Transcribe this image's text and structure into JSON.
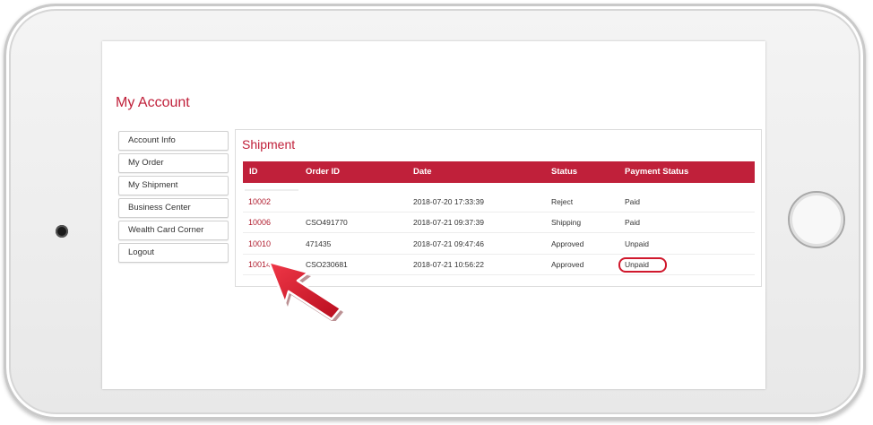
{
  "page": {
    "title": "My Account"
  },
  "sidebar": {
    "items": [
      {
        "label": "Account Info"
      },
      {
        "label": "My Order"
      },
      {
        "label": "My Shipment"
      },
      {
        "label": "Business Center"
      },
      {
        "label": "Wealth Card Corner"
      },
      {
        "label": "Logout"
      }
    ]
  },
  "shipment": {
    "title": "Shipment",
    "columns": [
      "ID",
      "Order ID",
      "Date",
      "Status",
      "Payment Status"
    ],
    "rows": [
      {
        "id": "10002",
        "order_id": "",
        "date": "2018-07-20 17:33:39",
        "status": "Reject",
        "payment_status": "Paid"
      },
      {
        "id": "10006",
        "order_id": "CSO491770",
        "date": "2018-07-21 09:37:39",
        "status": "Shipping",
        "payment_status": "Paid"
      },
      {
        "id": "10010",
        "order_id": "471435",
        "date": "2018-07-21 09:47:46",
        "status": "Approved",
        "payment_status": "Unpaid"
      },
      {
        "id": "10014",
        "order_id": "CSO230681",
        "date": "2018-07-21 10:56:22",
        "status": "Approved",
        "payment_status": "Unpaid"
      }
    ]
  },
  "colors": {
    "accent": "#c0203a",
    "annotation": "#d0182c"
  },
  "icons": {
    "annotation_arrow": "red-arrow-icon",
    "home_button": "home-button-icon"
  }
}
